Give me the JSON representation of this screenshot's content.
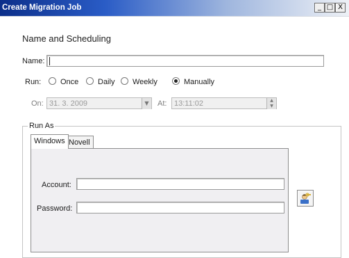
{
  "window": {
    "title": "Create Migration Job",
    "controls": {
      "minimize": "_",
      "maximize": "□",
      "close": "X"
    }
  },
  "section": {
    "title": "Name and Scheduling"
  },
  "name_field": {
    "label": "Name:",
    "value": ""
  },
  "run": {
    "label": "Run:",
    "options": [
      "Once",
      "Daily",
      "Weekly",
      "Manually"
    ],
    "selected": "Manually"
  },
  "schedule": {
    "on_label": "On:",
    "date_value": "31. 3. 2009",
    "at_label": "At:",
    "time_value": "13:11:02"
  },
  "run_as": {
    "legend": "Run As",
    "tabs": [
      "Windows",
      "Novell"
    ],
    "active_tab": "Windows",
    "account_label": "Account:",
    "account_value": "",
    "password_label": "Password:",
    "password_value": ""
  },
  "icons": {
    "browse_user": "user-key-icon",
    "date_dropdown": "chevron-down-icon",
    "time_spinner": "spinner-arrows-icon"
  }
}
